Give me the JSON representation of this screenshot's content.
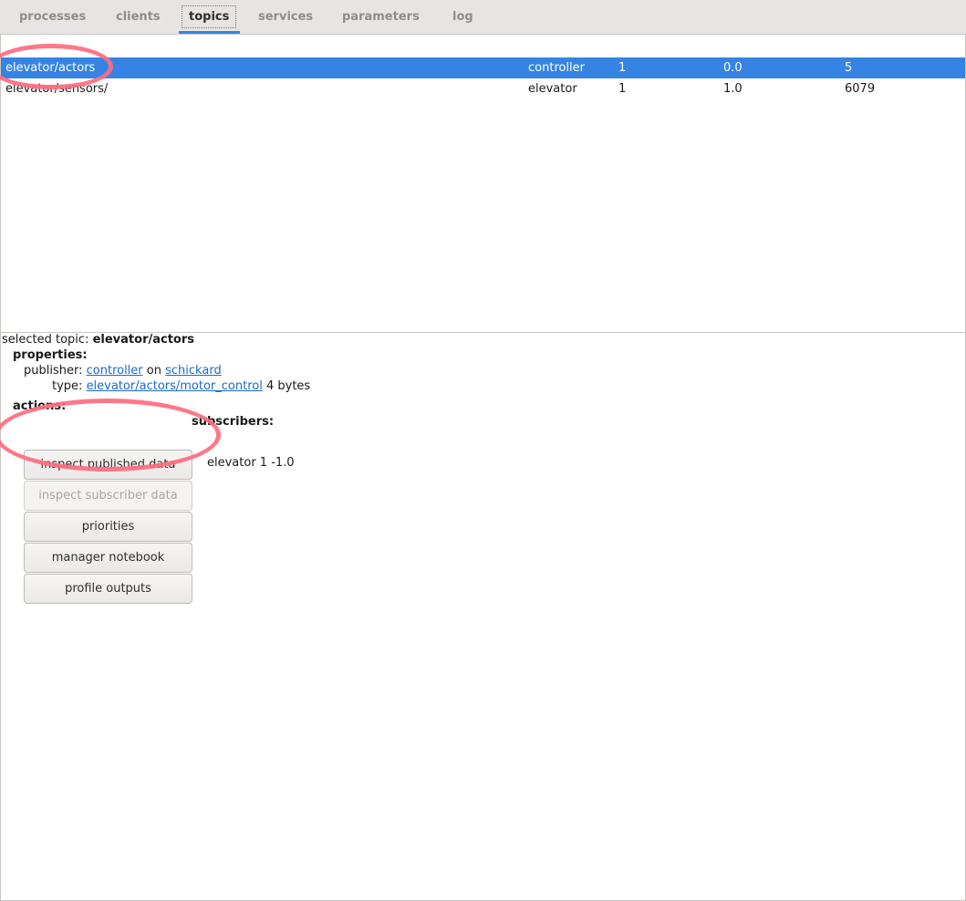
{
  "tabs": [
    {
      "label": "processes"
    },
    {
      "label": "clients"
    },
    {
      "label": "topics",
      "active": true
    },
    {
      "label": "services"
    },
    {
      "label": "parameters"
    },
    {
      "label": "log"
    }
  ],
  "topics": [
    {
      "name": "elevator/actors",
      "publisher": "controller",
      "subscribers": "1",
      "rate": "0.0",
      "count": "5",
      "selected": true
    },
    {
      "name": "elevator/sensors/",
      "publisher": "elevator",
      "subscribers": "1",
      "rate": "1.0",
      "count": "6079",
      "selected": false
    }
  ],
  "detail": {
    "selected_label": "selected topic:",
    "selected_topic": "elevator/actors",
    "properties_heading": "properties:",
    "publisher_label": "publisher:",
    "publisher_name": "controller",
    "on_label": "on",
    "host": "schickard",
    "type_label": "type:",
    "type_name": "elevator/actors/motor_control",
    "type_size": "4 bytes",
    "actions_heading": "actions:",
    "subscribers_heading": "subscribers:",
    "subscriber_entry": "elevator 1  -1.0"
  },
  "actions": {
    "inspect_published": "inspect published data",
    "inspect_subscriber": "inspect subscriber data",
    "priorities": "priorities",
    "manager_notebook": "manager notebook",
    "profile_outputs": "profile outputs"
  },
  "colors": {
    "accent": "#3584e4",
    "annotation": "#ff6b7e",
    "link": "#1b6acb"
  }
}
